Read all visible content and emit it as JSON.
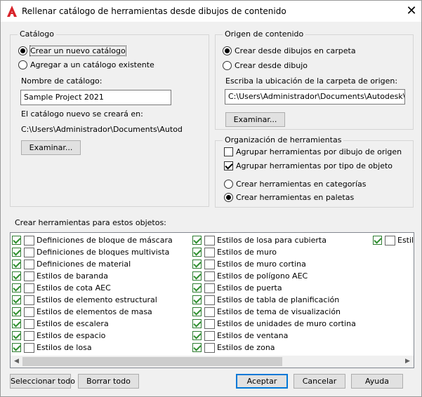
{
  "window": {
    "title": "Rellenar catálogo de herramientas desde dibujos de contenido"
  },
  "catalog": {
    "legend": "Catálogo",
    "radio_new": "Crear un nuevo catálogo",
    "radio_existing": "Agregar a un catálogo existente",
    "name_label": "Nombre de catálogo:",
    "name_value": "Sample Project 2021",
    "created_in_label": "El catálogo nuevo se creará en:",
    "created_in_path": "C:\\Users\\Administrador\\Documents\\Autodesk\\M",
    "browse": "Examinar..."
  },
  "source": {
    "legend": "Origen de contenido",
    "radio_folder": "Crear desde dibujos en carpeta",
    "radio_drawing": "Crear desde dibujo",
    "folder_label": "Escriba la ubicación de la carpeta de origen:",
    "folder_value": "C:\\Users\\Administrador\\Documents\\Autodesk\\Mis pr",
    "browse": "Examinar..."
  },
  "organization": {
    "legend": "Organización de herramientas",
    "group_by_drawing": "Agrupar herramientas por dibujo de origen",
    "group_by_type": "Agrupar herramientas por tipo de objeto",
    "in_categories": "Crear herramientas en categorías",
    "in_palettes": "Crear herramientas en paletas"
  },
  "objects": {
    "label": "Crear herramientas para estos objetos:",
    "col1": [
      "Definiciones de bloque de máscara",
      "Definiciones de bloques multivista",
      "Definiciones de material",
      "Estilos de baranda",
      "Estilos de cota AEC",
      "Estilos de elemento estructural",
      "Estilos de elementos de masa",
      "Estilos de escalera",
      "Estilos de espacio",
      "Estilos de losa"
    ],
    "col2": [
      "Estilos de losa para cubierta",
      "Estilos de muro",
      "Estilos de muro cortina",
      "Estilos de polígono AEC",
      "Estilos de puerta",
      "Estilos de tabla de planificación",
      "Estilos de tema de visualización",
      "Estilos de unidades de muro cortina",
      "Estilos de ventana",
      "Estilos de zona"
    ],
    "col3": [
      "Estilo"
    ]
  },
  "buttons": {
    "select_all": "Seleccionar todo",
    "clear_all": "Borrar todo",
    "ok": "Aceptar",
    "cancel": "Cancelar",
    "help": "Ayuda"
  }
}
